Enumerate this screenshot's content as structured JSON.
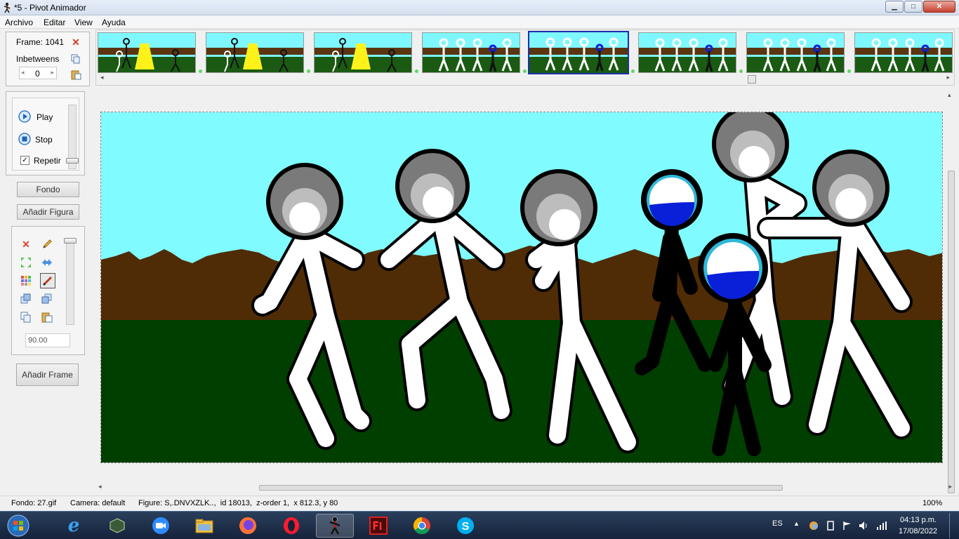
{
  "window": {
    "title": "*5 - Pivot Animador",
    "minimize": "▁",
    "maximize": "□",
    "close": "✕"
  },
  "menu": [
    "Archivo",
    "Editar",
    "View",
    "Ayuda"
  ],
  "frame_panel": {
    "frame_label": "Frame: 1041",
    "inbetweens_label": "Inbetweens",
    "inbetweens_value": "0"
  },
  "playback": {
    "play": "Play",
    "stop": "Stop",
    "repeat": "Repetir",
    "repeat_checked": true
  },
  "buttons": {
    "background": "Fondo",
    "add_figure": "Añadir Figura",
    "add_frame": "Añadir Frame"
  },
  "tools": {
    "angle_value": "90.00"
  },
  "status": {
    "background": "Fondo: 27.gif",
    "camera": "Camera: default",
    "figure": "Figure: S,.DNVXZLK..,  id 18013,  z-order 1,  x 812.3, y 80",
    "zoom": "100%"
  },
  "taskbar": {
    "language": "ES",
    "time": "04:13 p.m.",
    "date": "17/08/2022"
  },
  "colors": {
    "sky": "#80fbff",
    "dirt": "#4f2c06",
    "grass": "#013f00",
    "selected_frame": "#1a2fb0",
    "blue_figure": "#0a1fd8"
  }
}
